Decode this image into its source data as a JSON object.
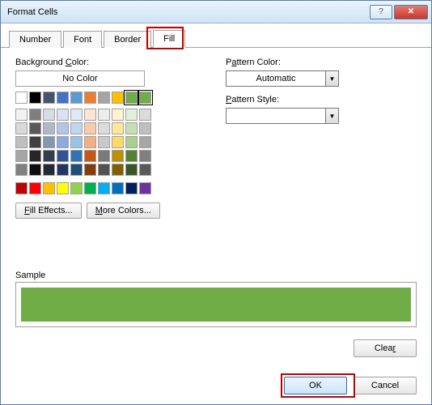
{
  "title": "Format Cells",
  "tabs": {
    "number": "Number",
    "font": "Font",
    "border": "Border",
    "fill": "Fill"
  },
  "fill": {
    "bg_label": "Background Color:",
    "bg_accel": "C",
    "no_color": "No Color",
    "fill_effects": "Fill Effects...",
    "more_colors": "More Colors...",
    "pattern_color_label": "Pattern Color:",
    "pattern_color_accel": "A",
    "pattern_color_value": "Automatic",
    "pattern_style_label": "Pattern Style:",
    "pattern_style_accel": "P",
    "pattern_style_value": ""
  },
  "sample_label": "Sample",
  "buttons": {
    "clear": "Clear",
    "ok": "OK",
    "cancel": "Cancel"
  },
  "colors": {
    "selected": "#70ad47",
    "theme_row1": [
      "#ffffff",
      "#000000",
      "#44546a",
      "#4472c4",
      "#5b9bd5",
      "#ed7d31",
      "#a5a5a5",
      "#ffc000",
      "#70ad47"
    ],
    "theme_grid": [
      [
        "#f2f2f2",
        "#7f7f7f",
        "#d6dce5",
        "#d9e1f2",
        "#deebf7",
        "#fce4d6",
        "#ededed",
        "#fff2cc",
        "#e2efda",
        "#dbdbdb"
      ],
      [
        "#d9d9d9",
        "#595959",
        "#adb9ca",
        "#b4c6e7",
        "#bdd7ee",
        "#f8cbad",
        "#dbdbdb",
        "#ffe699",
        "#c6e0b4",
        "#bfbfbf"
      ],
      [
        "#bfbfbf",
        "#404040",
        "#8497b0",
        "#8ea9db",
        "#9bc2e6",
        "#f4b084",
        "#c9c9c9",
        "#ffd966",
        "#a9d08e",
        "#a6a6a6"
      ],
      [
        "#a6a6a6",
        "#262626",
        "#333f4f",
        "#305496",
        "#2f75b5",
        "#c65911",
        "#7b7b7b",
        "#bf8f00",
        "#548235",
        "#808080"
      ],
      [
        "#808080",
        "#0d0d0d",
        "#222b35",
        "#203764",
        "#1f4e78",
        "#833c0c",
        "#525252",
        "#806000",
        "#375623",
        "#595959"
      ]
    ],
    "standard": [
      "#c00000",
      "#ff0000",
      "#ffc000",
      "#ffff00",
      "#92d050",
      "#00b050",
      "#00b0f0",
      "#0070c0",
      "#002060",
      "#7030a0"
    ]
  }
}
